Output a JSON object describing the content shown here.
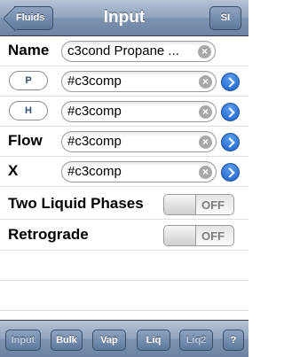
{
  "navbar": {
    "title": "Input",
    "back_label": "Fluids",
    "units_label": "SI"
  },
  "rows": {
    "name": {
      "label": "Name",
      "value": "c3cond Propane ..."
    },
    "p": {
      "button": "P",
      "value": "#c3comp"
    },
    "h": {
      "button": "H",
      "value": "#c3comp"
    },
    "flow": {
      "label": "Flow",
      "value": "#c3comp"
    },
    "x": {
      "label": "X",
      "value": "#c3comp"
    },
    "two_liquid": {
      "label": "Two Liquid Phases",
      "state": "OFF"
    },
    "retrograde": {
      "label": "Retrograde",
      "state": "OFF"
    }
  },
  "toolbar": {
    "input": "Input",
    "bulk": "Bulk",
    "vap": "Vap",
    "liq": "Liq",
    "liq2": "Liq2",
    "help": "?"
  },
  "icons": {
    "clear": "clear-icon",
    "disclosure": "disclosure-chevron-icon"
  },
  "colors": {
    "navbar": "#7e93b0",
    "disclosure": "#1a5fc7",
    "label_dark": "#000000"
  }
}
